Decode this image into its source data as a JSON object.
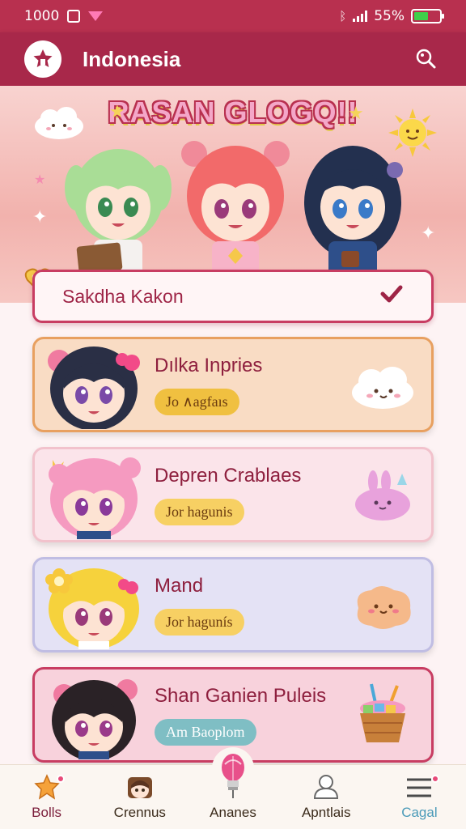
{
  "status_bar": {
    "time": "1000",
    "battery_level": "55%",
    "battery_fraction": 0.55,
    "battery_color": "#3ed14a"
  },
  "app_bar": {
    "title": "Indonesia",
    "background": "#a8284a",
    "logo_icon": "star-house-icon",
    "search_icon": "search-icon"
  },
  "hero": {
    "title": "RASAN GLOGQ!!"
  },
  "section_header": {
    "label": "Sakdha Kakon",
    "check_icon": "checkmark-icon",
    "badge_icon": "heart-badge-icon"
  },
  "cards": [
    {
      "name": "Dılka Inpries",
      "tag": "Jo ∧agfaıs",
      "card_bg": "#f9dcc4",
      "border": "#e8a060",
      "tag_bg": "#f0c040",
      "deco_icon": "cloud-icon"
    },
    {
      "name": "Depren Crablaes",
      "tag": "Jor hagunis",
      "card_bg": "#fbe4ea",
      "border": "#f2c2cc",
      "tag_bg": "#f7d063",
      "deco_icon": "bunny-icon"
    },
    {
      "name": "Mand",
      "tag": "Jor hagunís",
      "card_bg": "#e4e2f5",
      "border": "#c0bde3",
      "tag_bg": "#f7d063",
      "deco_icon": "cookie-icon"
    },
    {
      "name": "Shan Ganien Puleis",
      "tag": "Am Baoplom",
      "card_bg": "#f8d2dc",
      "border": "#c83d62",
      "tag_bg": "#7fbec4",
      "deco_icon": "drink-icon"
    }
  ],
  "bottom_nav": [
    {
      "label": "Bolls",
      "icon": "star-icon"
    },
    {
      "label": "Crennus",
      "icon": "character-icon"
    },
    {
      "label": "Ananes",
      "icon": "lightbulb-icon"
    },
    {
      "label": "Apntlais",
      "icon": "person-icon"
    },
    {
      "label": "Cagal",
      "icon": "menu-icon"
    }
  ]
}
